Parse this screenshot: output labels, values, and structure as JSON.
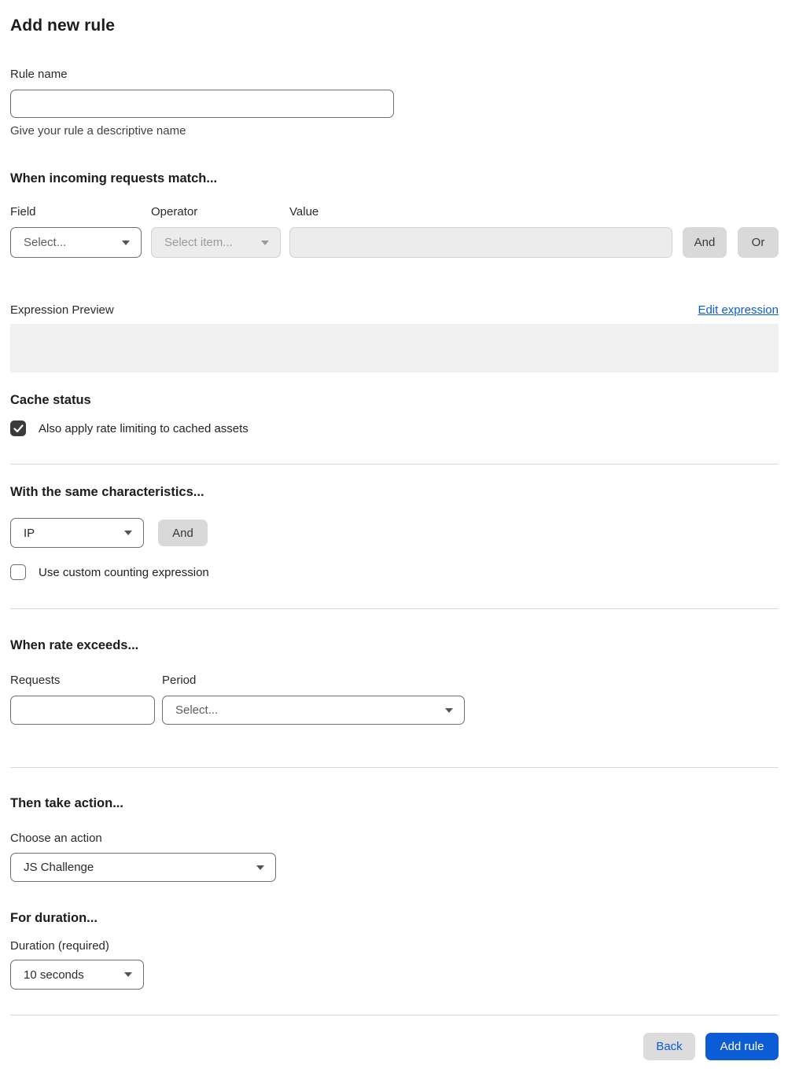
{
  "page": {
    "title": "Add new rule"
  },
  "rule_name": {
    "label": "Rule name",
    "value": "",
    "help": "Give your rule a descriptive name"
  },
  "match": {
    "heading": "When incoming requests match...",
    "field": {
      "label": "Field",
      "selected": "Select..."
    },
    "operator": {
      "label": "Operator",
      "selected": "Select item...",
      "disabled": true
    },
    "value": {
      "label": "Value",
      "value": "",
      "disabled": true
    },
    "and_label": "And",
    "or_label": "Or"
  },
  "expression": {
    "label": "Expression Preview",
    "edit_link": "Edit expression",
    "preview_value": ""
  },
  "cache": {
    "heading": "Cache status",
    "checkbox_label": "Also apply rate limiting to cached assets",
    "checked": true
  },
  "characteristics": {
    "heading": "With the same characteristics...",
    "select_value": "IP",
    "and_label": "And",
    "checkbox_label": "Use custom counting expression",
    "checked": false
  },
  "rate": {
    "heading": "When rate exceeds...",
    "requests": {
      "label": "Requests",
      "value": ""
    },
    "period": {
      "label": "Period",
      "selected": "Select..."
    }
  },
  "action": {
    "heading": "Then take action...",
    "label": "Choose an action",
    "selected": "JS Challenge"
  },
  "duration": {
    "heading": "For duration...",
    "label": "Duration (required)",
    "selected": "10 seconds"
  },
  "footer": {
    "back_label": "Back",
    "submit_label": "Add rule"
  },
  "colors": {
    "accent_blue": "#0b5cd5",
    "link_blue": "#0b5cd5",
    "button_gray": "#d9d9d9",
    "disabled_bg": "#ececec",
    "checkbox_dark": "#3a3a3a",
    "divider": "#d9d9d9"
  }
}
